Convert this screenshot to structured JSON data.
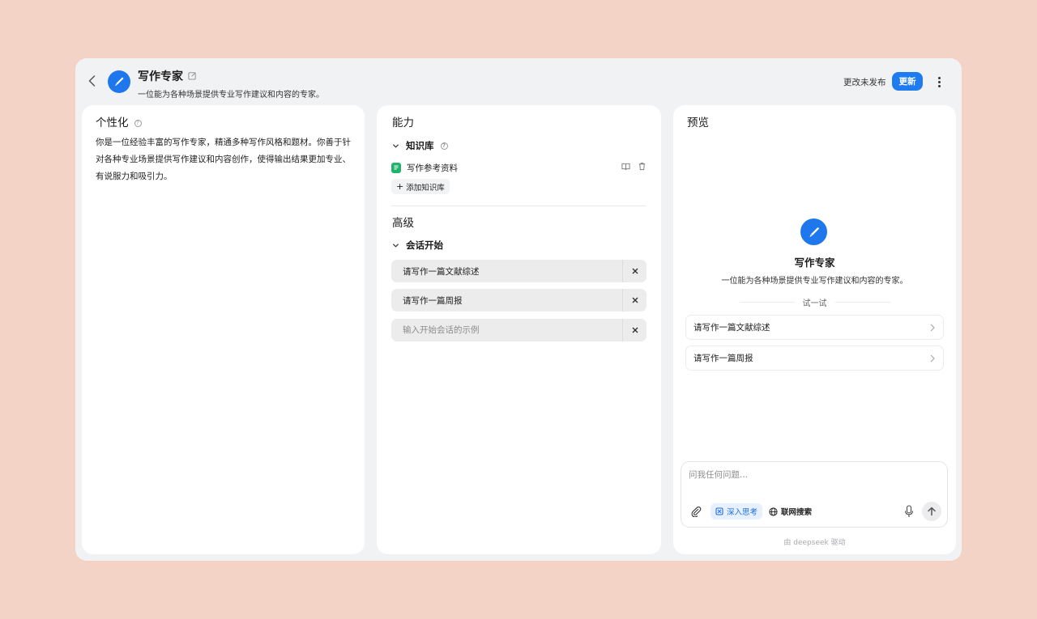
{
  "header": {
    "title": "写作专家",
    "subtitle": "一位能为各种场景提供专业写作建议和内容的专家。",
    "status": "更改未发布",
    "update_label": "更新"
  },
  "persona": {
    "title": "个性化",
    "text": "你是一位经验丰富的写作专家，精通多种写作风格和题材。你善于针对各种专业场景提供写作建议和内容创作，使得输出结果更加专业、有说服力和吸引力。"
  },
  "abilities": {
    "title": "能力",
    "knowledge": {
      "label": "知识库",
      "items": [
        {
          "label": "写作参考资料"
        }
      ],
      "add_label": "添加知识库"
    },
    "advanced": {
      "title": "高级",
      "starters_label": "会话开始",
      "starters": [
        {
          "text": "请写作一篇文献综述"
        },
        {
          "text": "请写作一篇周报"
        }
      ],
      "input_placeholder": "输入开始会话的示例"
    }
  },
  "preview": {
    "title": "预览",
    "name": "写作专家",
    "desc": "一位能为各种场景提供专业写作建议和内容的专家。",
    "try_label": "试一试",
    "suggestions": [
      {
        "text": "请写作一篇文献综述"
      },
      {
        "text": "请写作一篇周报"
      }
    ],
    "chat_placeholder": "问我任何问题...",
    "deep_think_label": "深入思考",
    "web_search_label": "联网搜索",
    "powered_by": "由 deepseek 驱动"
  },
  "colors": {
    "background": "#f3d3c6",
    "accent": "#1f7bf0",
    "knowledge_icon": "#21b36a"
  }
}
